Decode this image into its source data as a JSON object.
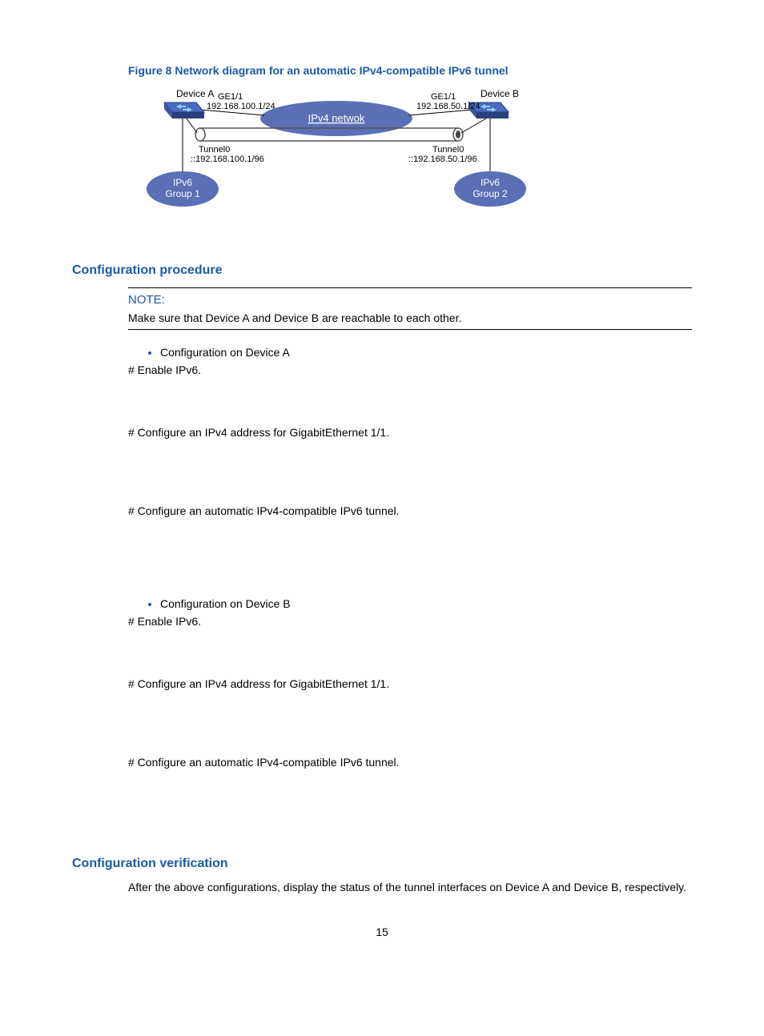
{
  "figure": {
    "caption": "Figure 8 Network diagram for an automatic IPv4-compatible IPv6 tunnel",
    "deviceA": "Device A",
    "deviceB": "Device B",
    "ge_a": "GE1/1",
    "ip_a": "192.168.100.1/24",
    "ge_b": "GE1/1",
    "ip_b": "192.168.50.1/24",
    "cloud": "IPv4 netwok",
    "tun_a_label": "Tunnel0",
    "tun_a_ip": "::192.168.100.1/96",
    "tun_b_label": "Tunnel0",
    "tun_b_ip": "::192.168.50.1/96",
    "group1": "IPv6",
    "group1b": "Group 1",
    "group2": "IPv6",
    "group2b": "Group 2"
  },
  "proc_heading": "Configuration procedure",
  "note": {
    "label": "NOTE:",
    "text": "Make sure that Device A and Device B are reachable to each other."
  },
  "devA": {
    "title": "Configuration on Device A",
    "s1": "# Enable IPv6.",
    "s2": "# Configure an IPv4 address for GigabitEthernet 1/1.",
    "s3": "# Configure an automatic IPv4-compatible IPv6 tunnel."
  },
  "devB": {
    "title": "Configuration on Device B",
    "s1": "# Enable IPv6.",
    "s2": "# Configure an IPv4 address for GigabitEthernet 1/1.",
    "s3": "# Configure an automatic IPv4-compatible IPv6 tunnel."
  },
  "verif_heading": "Configuration verification",
  "verif_text": "After the above configurations, display the status of the tunnel interfaces on Device A and Device B, respectively.",
  "pagenum": "15"
}
